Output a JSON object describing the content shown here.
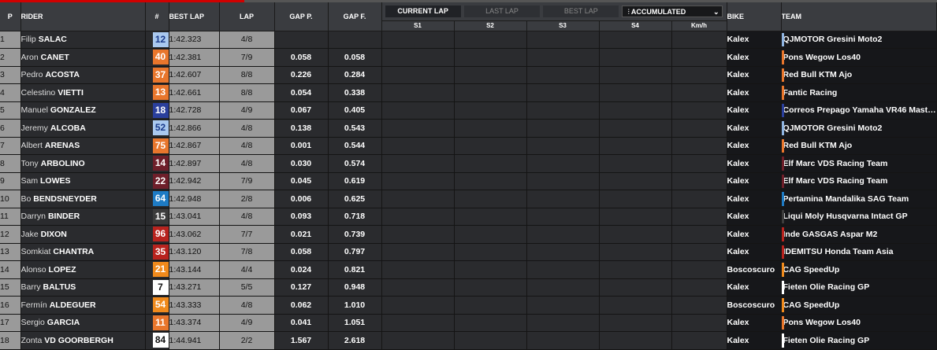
{
  "header": {
    "pos": "P",
    "rider": "RIDER",
    "num": "#",
    "best_lap": "BEST LAP",
    "lap": "LAP",
    "gap_p": "GAP P.",
    "gap_f": "GAP F.",
    "bike": "BIKE",
    "team": "TEAM",
    "tabs": {
      "current": "CURRENT LAP",
      "last": "LAST LAP",
      "best": "BEST LAP",
      "accumulated": "ACCUMULATED"
    },
    "sectors": [
      "S1",
      "S2",
      "S3",
      "S4",
      "Km/h"
    ]
  },
  "rows": [
    {
      "pos": "1",
      "first": "Filip",
      "last": "SALAC",
      "num": "12",
      "num_bg": "#a9c8ee",
      "num_fg": "#1a3a8a",
      "best": "1:42.323",
      "lap": "4/8",
      "gap_p": "",
      "gap_f": "",
      "bike": "Kalex",
      "team": "QJMOTOR Gresini Moto2",
      "team_color": "#8fb4e0"
    },
    {
      "pos": "2",
      "first": "Aron",
      "last": "CANET",
      "num": "40",
      "num_bg": "#e8762c",
      "num_fg": "#ffffff",
      "best": "1:42.381",
      "lap": "7/9",
      "gap_p": "0.058",
      "gap_f": "0.058",
      "bike": "Kalex",
      "team": "Pons Wegow Los40",
      "team_color": "#e8762c"
    },
    {
      "pos": "3",
      "first": "Pedro",
      "last": "ACOSTA",
      "num": "37",
      "num_bg": "#e8762c",
      "num_fg": "#ffffff",
      "best": "1:42.607",
      "lap": "8/8",
      "gap_p": "0.226",
      "gap_f": "0.284",
      "bike": "Kalex",
      "team": "Red Bull KTM Ajo",
      "team_color": "#e8762c"
    },
    {
      "pos": "4",
      "first": "Celestino",
      "last": "VIETTI",
      "num": "13",
      "num_bg": "#e8762c",
      "num_fg": "#ffffff",
      "best": "1:42.661",
      "lap": "8/8",
      "gap_p": "0.054",
      "gap_f": "0.338",
      "bike": "Kalex",
      "team": "Fantic Racing",
      "team_color": "#e8762c"
    },
    {
      "pos": "5",
      "first": "Manuel",
      "last": "GONZALEZ",
      "num": "18",
      "num_bg": "#2a3f9c",
      "num_fg": "#ffffff",
      "best": "1:42.728",
      "lap": "4/9",
      "gap_p": "0.067",
      "gap_f": "0.405",
      "bike": "Kalex",
      "team": "Correos Prepago Yamaha VR46 Mast…",
      "team_color": "#2a3f9c"
    },
    {
      "pos": "6",
      "first": "Jeremy",
      "last": "ALCOBA",
      "num": "52",
      "num_bg": "#a9c8ee",
      "num_fg": "#1a3a8a",
      "best": "1:42.866",
      "lap": "4/8",
      "gap_p": "0.138",
      "gap_f": "0.543",
      "bike": "Kalex",
      "team": "QJMOTOR Gresini Moto2",
      "team_color": "#8fb4e0"
    },
    {
      "pos": "7",
      "first": "Albert",
      "last": "ARENAS",
      "num": "75",
      "num_bg": "#e8762c",
      "num_fg": "#ffffff",
      "best": "1:42.867",
      "lap": "4/8",
      "gap_p": "0.001",
      "gap_f": "0.544",
      "bike": "Kalex",
      "team": "Red Bull KTM Ajo",
      "team_color": "#e8762c"
    },
    {
      "pos": "8",
      "first": "Tony",
      "last": "ARBOLINO",
      "num": "14",
      "num_bg": "#6e1f2a",
      "num_fg": "#ffffff",
      "best": "1:42.897",
      "lap": "4/8",
      "gap_p": "0.030",
      "gap_f": "0.574",
      "bike": "Kalex",
      "team": "Elf Marc VDS Racing Team",
      "team_color": "#6e1f2a"
    },
    {
      "pos": "9",
      "first": "Sam",
      "last": "LOWES",
      "num": "22",
      "num_bg": "#6e1f2a",
      "num_fg": "#ffffff",
      "best": "1:42.942",
      "lap": "7/9",
      "gap_p": "0.045",
      "gap_f": "0.619",
      "bike": "Kalex",
      "team": "Elf Marc VDS Racing Team",
      "team_color": "#6e1f2a"
    },
    {
      "pos": "10",
      "first": "Bo",
      "last": "BENDSNEYDER",
      "num": "64",
      "num_bg": "#1e7bc4",
      "num_fg": "#ffffff",
      "best": "1:42.948",
      "lap": "2/8",
      "gap_p": "0.006",
      "gap_f": "0.625",
      "bike": "Kalex",
      "team": "Pertamina Mandalika SAG Team",
      "team_color": "#1e7bc4"
    },
    {
      "pos": "11",
      "first": "Darryn",
      "last": "BINDER",
      "num": "15",
      "num_bg": "#3c3c3c",
      "num_fg": "#ffffff",
      "best": "1:43.041",
      "lap": "4/8",
      "gap_p": "0.093",
      "gap_f": "0.718",
      "bike": "Kalex",
      "team": "Liqui Moly Husqvarna Intact GP",
      "team_color": "#3c3c3c"
    },
    {
      "pos": "12",
      "first": "Jake",
      "last": "DIXON",
      "num": "96",
      "num_bg": "#b8231e",
      "num_fg": "#ffffff",
      "best": "1:43.062",
      "lap": "7/7",
      "gap_p": "0.021",
      "gap_f": "0.739",
      "bike": "Kalex",
      "team": "Inde GASGAS Aspar M2",
      "team_color": "#b8231e"
    },
    {
      "pos": "13",
      "first": "Somkiat",
      "last": "CHANTRA",
      "num": "35",
      "num_bg": "#b8231e",
      "num_fg": "#ffffff",
      "best": "1:43.120",
      "lap": "7/8",
      "gap_p": "0.058",
      "gap_f": "0.797",
      "bike": "Kalex",
      "team": "IDEMITSU Honda Team Asia",
      "team_color": "#b8231e"
    },
    {
      "pos": "14",
      "first": "Alonso",
      "last": "LOPEZ",
      "num": "21",
      "num_bg": "#f08a1c",
      "num_fg": "#ffffff",
      "best": "1:43.144",
      "lap": "4/4",
      "gap_p": "0.024",
      "gap_f": "0.821",
      "bike": "Boscoscuro",
      "team": "CAG SpeedUp",
      "team_color": "#f08a1c"
    },
    {
      "pos": "15",
      "first": "Barry",
      "last": "BALTUS",
      "num": "7",
      "num_bg": "#ffffff",
      "num_fg": "#111111",
      "best": "1:43.271",
      "lap": "5/5",
      "gap_p": "0.127",
      "gap_f": "0.948",
      "bike": "Kalex",
      "team": "Fieten Olie Racing GP",
      "team_color": "#ffffff"
    },
    {
      "pos": "16",
      "first": "Fermín",
      "last": "ALDEGUER",
      "num": "54",
      "num_bg": "#f08a1c",
      "num_fg": "#ffffff",
      "best": "1:43.333",
      "lap": "4/8",
      "gap_p": "0.062",
      "gap_f": "1.010",
      "bike": "Boscoscuro",
      "team": "CAG SpeedUp",
      "team_color": "#f08a1c"
    },
    {
      "pos": "17",
      "first": "Sergio",
      "last": "GARCIA",
      "num": "11",
      "num_bg": "#e8762c",
      "num_fg": "#ffffff",
      "best": "1:43.374",
      "lap": "4/9",
      "gap_p": "0.041",
      "gap_f": "1.051",
      "bike": "Kalex",
      "team": "Pons Wegow Los40",
      "team_color": "#e8762c"
    },
    {
      "pos": "18",
      "first": "Zonta",
      "last": "VD GOORBERGH",
      "num": "84",
      "num_bg": "#ffffff",
      "num_fg": "#111111",
      "best": "1:44.941",
      "lap": "2/2",
      "gap_p": "1.567",
      "gap_f": "2.618",
      "bike": "Kalex",
      "team": "Fieten Olie Racing GP",
      "team_color": "#ffffff"
    }
  ]
}
